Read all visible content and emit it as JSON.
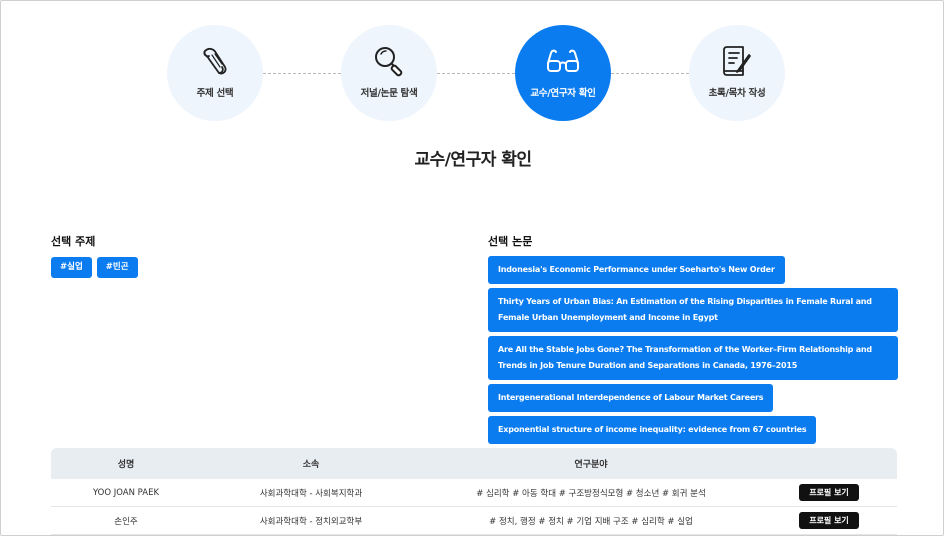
{
  "stepper": {
    "steps": [
      {
        "label": "주제 선택",
        "icon": "scroll-icon",
        "active": false
      },
      {
        "label": "저널/논문 탐색",
        "icon": "magnifier-icon",
        "active": false
      },
      {
        "label": "교수/연구자 확인",
        "icon": "glasses-icon",
        "active": true
      },
      {
        "label": "초록/목차 작성",
        "icon": "document-pen-icon",
        "active": false
      }
    ]
  },
  "page_title": "교수/연구자 확인",
  "selected_topics": {
    "title": "선택 주제",
    "tags": [
      "#실업",
      "#빈곤"
    ]
  },
  "selected_papers": {
    "title": "선택 논문",
    "items": [
      "Indonesia's Economic Performance under Soeharto's New Order",
      "Thirty Years of Urban Bias: An Estimation of the Rising Disparities in Female Rural and Female Urban Unemployment and Income in Egypt",
      "Are All the Stable Jobs Gone? The Transformation of the Worker–Firm Relationship and Trends in Job Tenure Duration and Separations in Canada, 1976–2015",
      "Intergenerational Interdependence of Labour Market Careers",
      "Exponential structure of income inequality: evidence from 67 countries"
    ]
  },
  "researchers_table": {
    "headers": [
      "성명",
      "소속",
      "연구분야",
      ""
    ],
    "rows": [
      {
        "name": "YOO JOAN PAEK",
        "affiliation": "사회과학대학 - 사회복지학과",
        "field": "# 심리학 # 아동 학대 # 구조방정식모형 # 청소년 # 회귀 분석",
        "action": "프로필 보기"
      },
      {
        "name": "손인주",
        "affiliation": "사회과학대학 - 정치외교학부",
        "field": "# 정치, 행정 # 정치 # 기업 지배 구조 # 심리학 # 실업",
        "action": "프로필 보기"
      }
    ]
  },
  "colors": {
    "accent": "#0a7cf0",
    "step_bg": "#eef5fc",
    "table_head": "#e8edf2",
    "button_dark": "#111111"
  }
}
